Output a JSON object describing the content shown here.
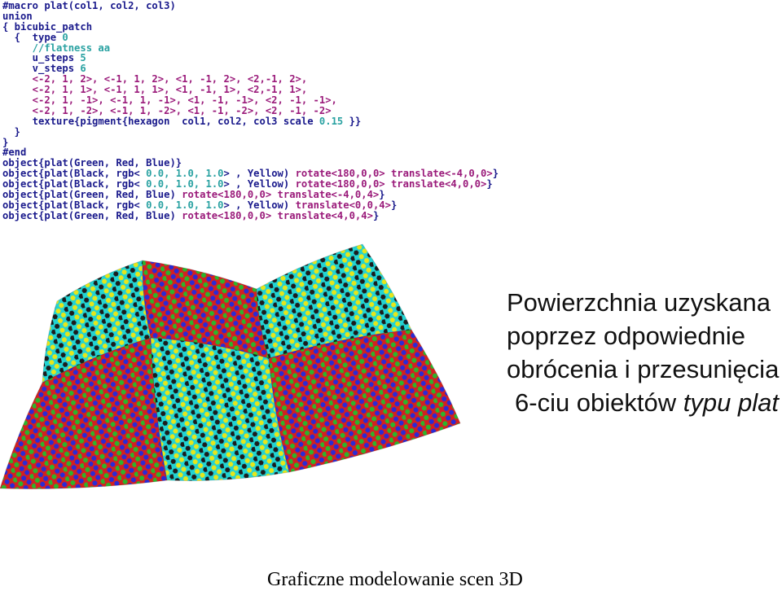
{
  "code_lines": [
    [
      {
        "t": "#macro plat(col1, col2, col3)",
        "c": "kw"
      }
    ],
    [
      {
        "t": "union",
        "c": "kw"
      }
    ],
    [
      {
        "t": "{ bicubic_patch",
        "c": "kw"
      }
    ],
    [
      {
        "t": "  {  type ",
        "c": "kw"
      },
      {
        "t": "0",
        "c": "num"
      }
    ],
    [
      {
        "t": "     //flatness aa",
        "c": "cmt"
      }
    ],
    [
      {
        "t": "     u_steps ",
        "c": "kw"
      },
      {
        "t": "5",
        "c": "num"
      }
    ],
    [
      {
        "t": "     v_steps ",
        "c": "kw"
      },
      {
        "t": "6",
        "c": "num"
      }
    ],
    [
      {
        "t": "     <-2, 1, 2>, <-1, 1, 2>, <1, -1, 2>, <2,-1, 2>,",
        "c": "str"
      }
    ],
    [
      {
        "t": "     <-2, 1, 1>, <-1, 1, 1>, <1, -1, 1>, <2,-1, 1>,",
        "c": "str"
      }
    ],
    [
      {
        "t": "     <-2, 1, -1>, <-1, 1, -1>, <1, -1, -1>, <2, -1, -1>,",
        "c": "str"
      }
    ],
    [
      {
        "t": "     <-2, 1, -2>, <-1, 1, -2>, <1, -1, -2>, <2, -1, -2>",
        "c": "str"
      }
    ],
    [
      {
        "t": "     texture{pigment{hexagon  col1, col2, col3 scale ",
        "c": "kw"
      },
      {
        "t": "0.15",
        "c": "num"
      },
      {
        "t": " }}",
        "c": "kw"
      }
    ],
    [
      {
        "t": "  }",
        "c": "kw"
      }
    ],
    [
      {
        "t": "}",
        "c": "kw"
      }
    ],
    [
      {
        "t": "#end",
        "c": "kw"
      }
    ],
    [
      {
        "t": "object{plat(Green, Red, Blue)}",
        "c": "kw"
      }
    ],
    [
      {
        "t": "object{plat(Black, rgb< ",
        "c": "kw"
      },
      {
        "t": "0.0, 1.0, 1.0",
        "c": "num"
      },
      {
        "t": "> , Yellow) ",
        "c": "kw"
      },
      {
        "t": "rotate<180,0,0> translate<-4,0,0>",
        "c": "str"
      },
      {
        "t": "}",
        "c": "kw"
      }
    ],
    [
      {
        "t": "object{plat(Black, rgb< ",
        "c": "kw"
      },
      {
        "t": "0.0, 1.0, 1.0",
        "c": "num"
      },
      {
        "t": "> , Yellow) ",
        "c": "kw"
      },
      {
        "t": "rotate<180,0,0> translate<4,0,0>",
        "c": "str"
      },
      {
        "t": "}",
        "c": "kw"
      }
    ],
    [
      {
        "t": "object{plat(Green, Red, Blue) ",
        "c": "kw"
      },
      {
        "t": "rotate<180,0,0> translate<-4,0,4>",
        "c": "str"
      },
      {
        "t": "}",
        "c": "kw"
      }
    ],
    [
      {
        "t": "object{plat(Black, rgb< ",
        "c": "kw"
      },
      {
        "t": "0.0, 1.0, 1.0",
        "c": "num"
      },
      {
        "t": "> , Yellow) ",
        "c": "kw"
      },
      {
        "t": "translate<0,0,4>",
        "c": "str"
      },
      {
        "t": "}",
        "c": "kw"
      }
    ],
    [
      {
        "t": "object{plat(Green, Red, Blue) ",
        "c": "kw"
      },
      {
        "t": "rotate<180,0,0> translate<4,0,4>",
        "c": "str"
      },
      {
        "t": "}",
        "c": "kw"
      }
    ]
  ],
  "caption": {
    "line1": "Powierzchnia uzyskana",
    "line2": "poprzez odpowiednie",
    "line3": "obrócenia i przesunięcia",
    "line4_prefix": "6-ciu obiektów ",
    "line4_emphasis": "typu plat"
  },
  "footer": "Graficzne modelowanie scen 3D",
  "surface_patches": [
    {
      "palette": [
        "#1c1c1c",
        "#22d3d3",
        "#e6e61a"
      ]
    },
    {
      "palette": [
        "#2bb52b",
        "#d42020",
        "#2a2ad6"
      ]
    },
    {
      "palette": [
        "#1c1c1c",
        "#22d3d3",
        "#e6e61a"
      ]
    },
    {
      "palette": [
        "#2bb52b",
        "#d42020",
        "#2a2ad6"
      ]
    },
    {
      "palette": [
        "#1c1c1c",
        "#22d3d3",
        "#e6e61a"
      ]
    },
    {
      "palette": [
        "#2bb52b",
        "#d42020",
        "#2a2ad6"
      ]
    }
  ]
}
